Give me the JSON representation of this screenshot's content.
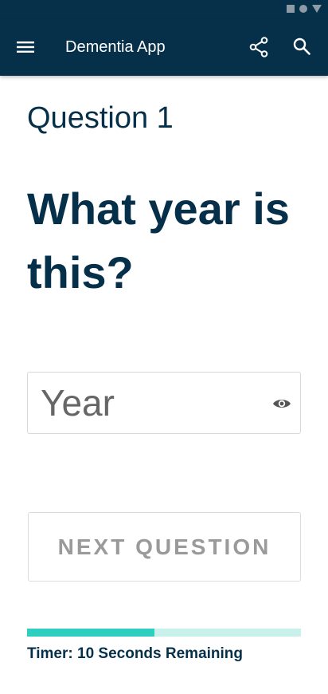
{
  "status_bar": {
    "icons": [
      "square-icon",
      "circle-icon",
      "triangle-down-icon"
    ],
    "icon_color": "#8e9aa6"
  },
  "app_bar": {
    "title": "Dementia App",
    "background": "#06304a",
    "icons": [
      "menu-icon",
      "share-icon",
      "search-icon"
    ]
  },
  "question": {
    "number_label": "Question 1",
    "text": "What year is this?"
  },
  "answer_field": {
    "placeholder": "Year",
    "value": "",
    "icon": "eye-icon"
  },
  "next_button": {
    "label": "NEXT QUESTION"
  },
  "timer": {
    "label": "Timer: 10 Seconds Remaining",
    "progress_fraction": 0.465,
    "fill_color": "#2ecfbe",
    "track_color": "#c8f1eb"
  }
}
